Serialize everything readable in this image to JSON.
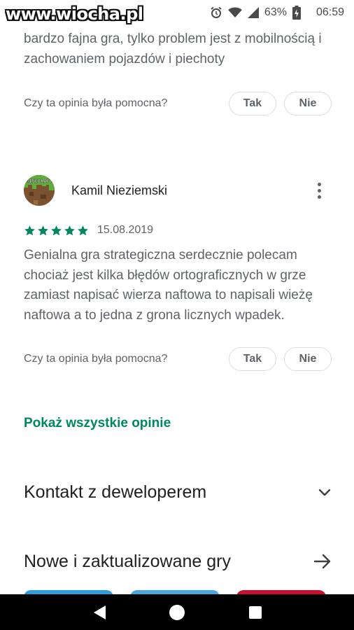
{
  "status_bar": {
    "watermark": "www.wiocha.pl",
    "battery": "63%",
    "time": "06:59",
    "icons": [
      "alarm-icon",
      "wifi-icon",
      "signal-icon",
      "battery-icon"
    ]
  },
  "previous_review": {
    "text": "bardzo fajna gra, tylko problem jest z mobilnością i zachowaniem pojazdów i piechoty",
    "helpful_question": "Czy ta opinia była pomocna?",
    "yes_label": "Tak",
    "no_label": "Nie"
  },
  "review": {
    "author": "Kamil Nieziemski",
    "avatar_text": "MINECRAFT",
    "rating": 5,
    "date": "15.08.2019",
    "text": "Genialna gra strategiczna serdecznie polecam chociaż jest kilka błędów ortograficznych w grze zamiast napisać wierza naftowa to napisali wieżę naftowa a to jedna z grona licznych wpadek.",
    "helpful_question": "Czy ta opinia była pomocna?",
    "yes_label": "Tak",
    "no_label": "Nie"
  },
  "show_all_reviews": "Pokaż wszystkie opinie",
  "sections": {
    "developer_contact": "Kontakt z deweloperem",
    "new_updated_games": "Nowe i zaktualizowane gry"
  },
  "colors": {
    "accent_green": "#01875f",
    "star_green": "#01875f",
    "text_secondary": "#5f6368"
  }
}
